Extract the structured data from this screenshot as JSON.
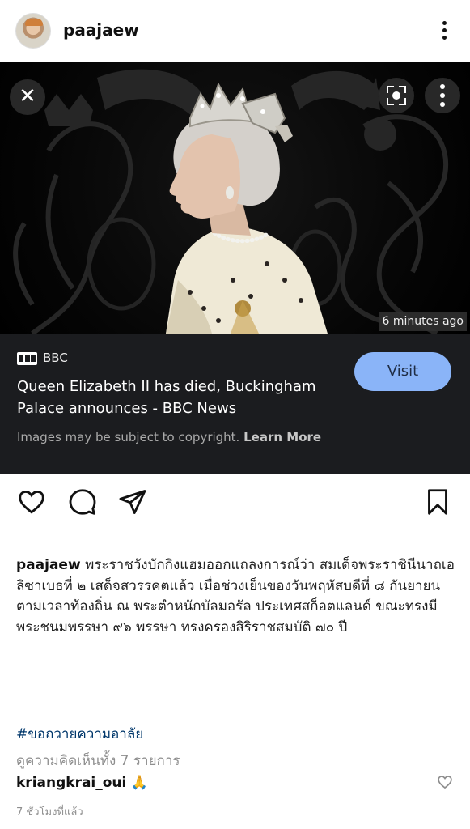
{
  "header": {
    "username": "paajaew",
    "avatar_icon": "profile-avatar",
    "more_icon": "more-vertical-icon"
  },
  "media": {
    "close_icon": "close-icon",
    "lens_icon": "visual-search-icon",
    "more_icon": "more-vertical-icon",
    "time_badge": "6 minutes ago",
    "source_name": "BBC",
    "headline": "Queen Elizabeth II has died, Buckingham Palace announces - BBC News",
    "visit_label": "Visit",
    "copyright_text": "Images may be subject to copyright.",
    "learn_more": "Learn More",
    "accent_color": "#8ab4f8"
  },
  "actions": {
    "like_icon": "heart-icon",
    "comment_icon": "comment-icon",
    "share_icon": "send-icon",
    "save_icon": "bookmark-icon"
  },
  "caption": {
    "username": "paajaew",
    "text": "พระราชวังบักกิงแฮมออกแถลงการณ์ว่า สมเด็จพระราชินีนาถเอลิซาเบธที่ ๒ เสด็จสวรรคตแล้ว เมื่อช่วงเย็นของวันพฤหัสบดีที่ ๘ กันยายน ตามเวลาท้องถิ่น ณ พระตำหนักบัลมอรัล ประเทศสก็อตแลนด์ ขณะทรงมีพระชนมพรรษา ๙๖ พรรษา ทรงครองสิริราชสมบัติ ๗๐ ปี"
  },
  "hashtag": "#ขอถวายความอาลัย",
  "view_comments": "ดูความคิดเห็นทั้ง 7 รายการ",
  "comment": {
    "username": "kriangkrai_oui",
    "emoji": "🙏"
  },
  "timestamp": "7 ชั่วโมงที่แล้ว"
}
